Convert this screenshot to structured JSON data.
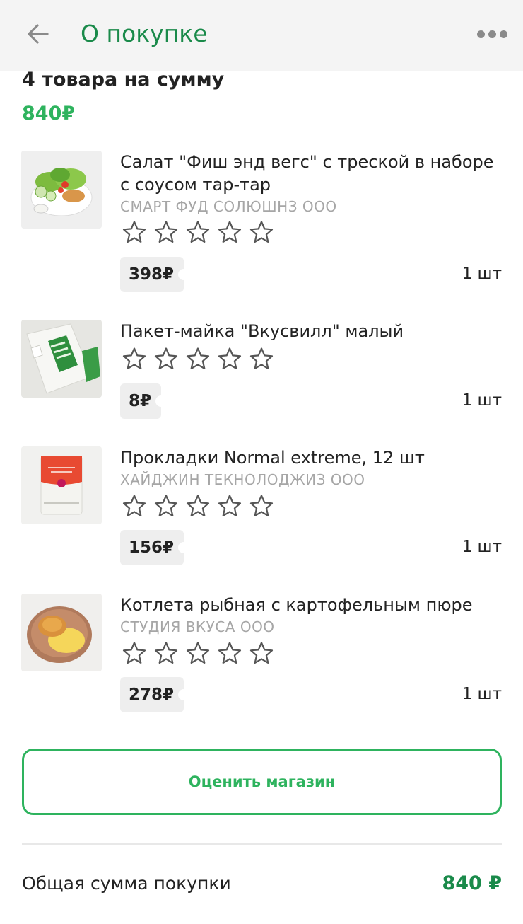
{
  "header": {
    "title": "О покупке",
    "back_icon": "arrow-left-icon",
    "more_icon": "more-dots-icon"
  },
  "summary": {
    "title": "4 товара на сумму",
    "total": "840₽"
  },
  "items": [
    {
      "name": "Салат \"Фиш энд вегс\" с треской в наборе с соусом тар-тар",
      "vendor": "СМАРТ ФУД СОЛЮШНЗ ООО",
      "price": "398₽",
      "qty": "1 шт",
      "rating": 0,
      "image": "salad-photo"
    },
    {
      "name": "Пакет-майка \"Вкусвилл\" малый",
      "vendor": "",
      "price": "8₽",
      "qty": "1 шт",
      "rating": 0,
      "image": "bag-photo"
    },
    {
      "name": "Прокладки Normal extreme, 12 шт",
      "vendor": "ХАЙДЖИН ТЕКНОЛОДЖИЗ ООО",
      "price": "156₽",
      "qty": "1 шт",
      "rating": 0,
      "image": "pads-photo"
    },
    {
      "name": "Котлета рыбная с картофельным пюре",
      "vendor": "СТУДИЯ ВКУСА ООО",
      "price": "278₽",
      "qty": "1 шт",
      "rating": 0,
      "image": "fish-cutlet-photo"
    }
  ],
  "rate_store_button": "Оценить магазин",
  "footer": {
    "total_label": "Общая сумма покупки",
    "total_value": "840 ₽"
  },
  "colors": {
    "accent": "#2eb35e",
    "accent_dark": "#1a8a4a",
    "muted": "#a6a6a6",
    "header_bg": "#f4f4f4"
  }
}
